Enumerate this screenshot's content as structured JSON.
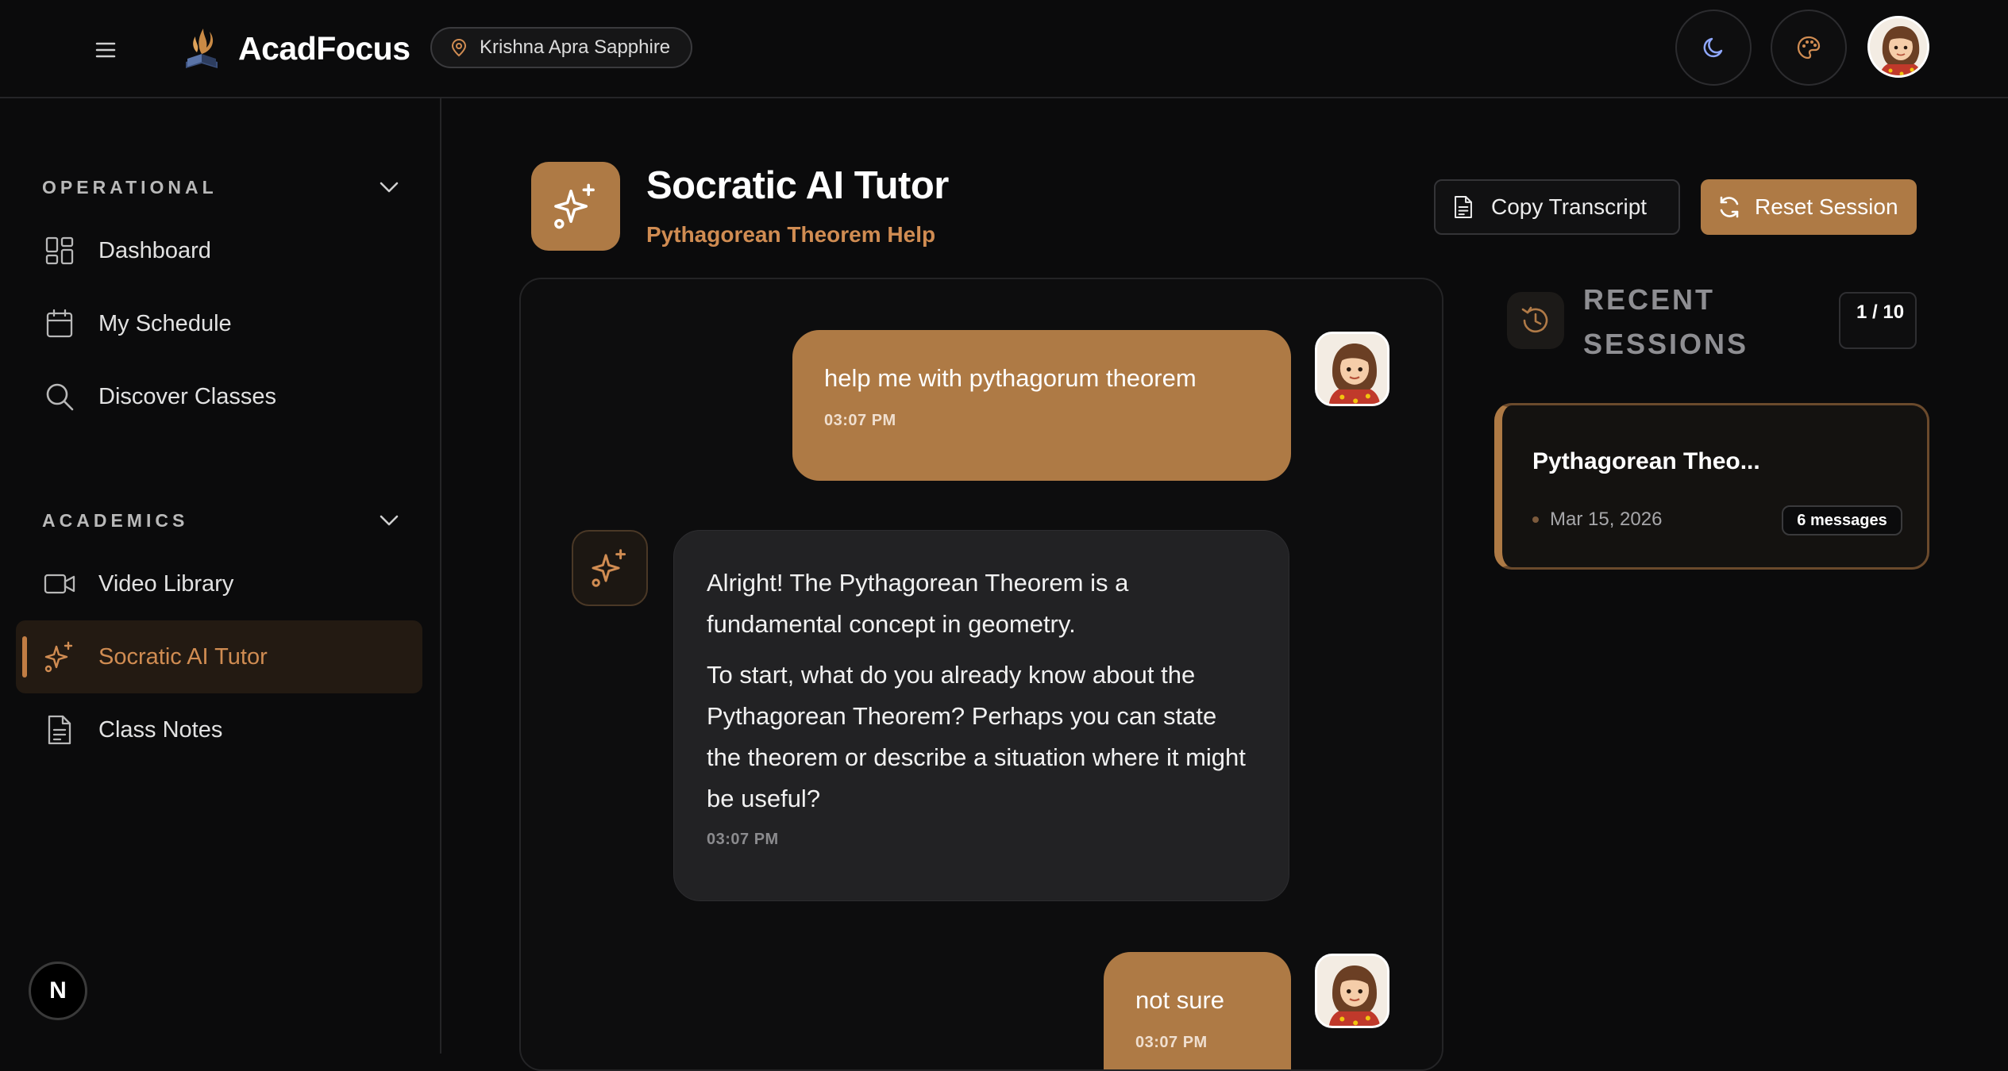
{
  "header": {
    "app_name": "AcadFocus",
    "location": "Krishna Apra Sapphire"
  },
  "sidebar": {
    "sections": [
      {
        "title": "OPERATIONAL",
        "items": [
          {
            "label": "Dashboard",
            "icon": "dashboard-icon"
          },
          {
            "label": "My Schedule",
            "icon": "calendar-icon"
          },
          {
            "label": "Discover Classes",
            "icon": "search-icon"
          }
        ]
      },
      {
        "title": "ACADEMICS",
        "items": [
          {
            "label": "Video Library",
            "icon": "video-icon"
          },
          {
            "label": "Socratic AI Tutor",
            "icon": "sparkles-icon",
            "active": true
          },
          {
            "label": "Class Notes",
            "icon": "document-icon"
          }
        ]
      }
    ],
    "badge": "N"
  },
  "main": {
    "title": "Socratic AI Tutor",
    "subtitle": "Pythagorean Theorem Help",
    "copy_label": "Copy Transcript",
    "reset_label": "Reset Session"
  },
  "chat": {
    "messages": [
      {
        "role": "user",
        "text": "help me with pythagorum theorem",
        "time": "03:07 PM"
      },
      {
        "role": "ai",
        "paragraphs": [
          "Alright! The Pythagorean Theorem is a fundamental concept in geometry.",
          "To start, what do you already know about the Pythagorean Theorem? Perhaps you can state the theorem or describe a situation where it might be useful?"
        ],
        "time": "03:07 PM"
      },
      {
        "role": "user",
        "text": "not sure",
        "time": "03:07 PM"
      }
    ]
  },
  "recent": {
    "title": "RECENT SESSIONS",
    "count": "1 / 10",
    "sessions": [
      {
        "title": "Pythagorean Theo...",
        "date": "Mar 15, 2026",
        "messages": "6 messages"
      }
    ]
  },
  "colors": {
    "accent": "#ae7a45",
    "accent_text": "#d08c52",
    "background": "#0b0b0c",
    "panel": "#222224"
  }
}
